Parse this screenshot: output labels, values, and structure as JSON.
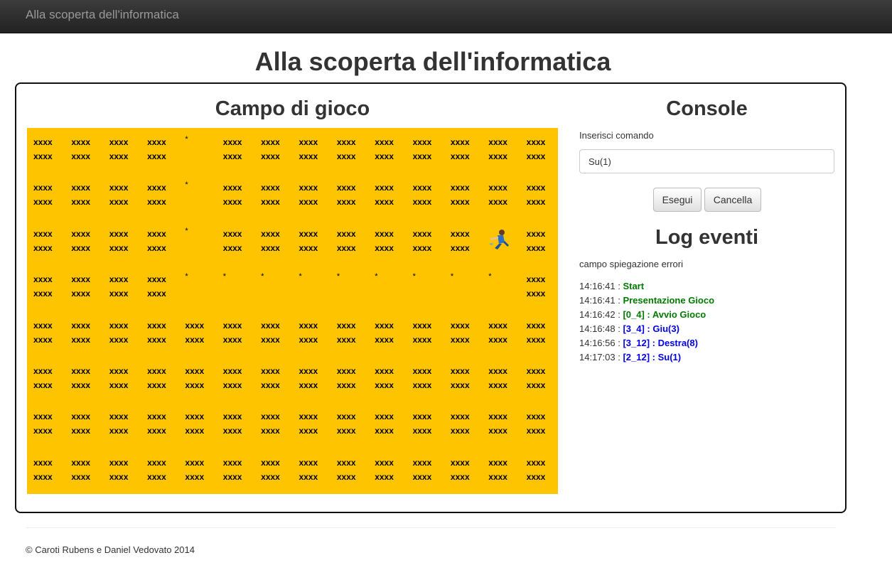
{
  "navbar": {
    "brand": "Alla scoperta dell'informatica"
  },
  "page_title": "Alla scoperta dell'informatica",
  "game": {
    "title": "Campo di gioco",
    "rows": [
      [
        "X",
        "X",
        "X",
        "X",
        "*",
        "X",
        "X",
        "X",
        "X",
        "X",
        "X",
        "X",
        "X",
        "X"
      ],
      [
        "X",
        "X",
        "X",
        "X",
        "*",
        "X",
        "X",
        "X",
        "X",
        "X",
        "X",
        "X",
        "X",
        "X"
      ],
      [
        "X",
        "X",
        "X",
        "X",
        "*",
        "X",
        "X",
        "X",
        "X",
        "X",
        "X",
        "X",
        "P",
        "X"
      ],
      [
        "X",
        "X",
        "X",
        "X",
        "*",
        "*",
        "*",
        "*",
        "*",
        "*",
        "*",
        "*",
        "*",
        "X"
      ],
      [
        "X",
        "X",
        "X",
        "X",
        "X",
        "X",
        "X",
        "X",
        "X",
        "X",
        "X",
        "X",
        "X",
        "X"
      ],
      [
        "X",
        "X",
        "X",
        "X",
        "X",
        "X",
        "X",
        "X",
        "X",
        "X",
        "X",
        "X",
        "X",
        "X"
      ],
      [
        "X",
        "X",
        "X",
        "X",
        "X",
        "X",
        "X",
        "X",
        "X",
        "X",
        "X",
        "X",
        "X",
        "X"
      ],
      [
        "X",
        "X",
        "X",
        "X",
        "X",
        "X",
        "X",
        "X",
        "X",
        "X",
        "X",
        "X",
        "X",
        "X"
      ]
    ],
    "wall_text": "xxxx\nxxxx",
    "path_text": "*",
    "player_icon": "player-character-icon",
    "background": "#ffc400"
  },
  "console": {
    "title": "Console",
    "label": "Inserisci comando",
    "value": "Su(1)",
    "run": "Esegui",
    "clear": "Cancella"
  },
  "log": {
    "title": "Log eventi",
    "errors": "campo spiegazione errori",
    "entries": [
      {
        "time": "14:16:41 : ",
        "text": "Start",
        "color": "#007a00"
      },
      {
        "time": "14:16:41 : ",
        "text": "Presentazione Gioco",
        "color": "#007a00"
      },
      {
        "time": "14:16:42 : ",
        "text": "[0_4] : Avvio Gioco",
        "color": "#007a00"
      },
      {
        "time": "14:16:48 : ",
        "text": "[3_4] : Giu(3)",
        "color": "#0000ee"
      },
      {
        "time": "14:16:56 : ",
        "text": "[3_12] : Destra(8)",
        "color": "#0000ee"
      },
      {
        "time": "14:17:03 : ",
        "text": "[2_12] : Su(1)",
        "color": "#0000ee"
      }
    ]
  },
  "footer": "© Caroti Rubens e Daniel Vedovato 2014"
}
